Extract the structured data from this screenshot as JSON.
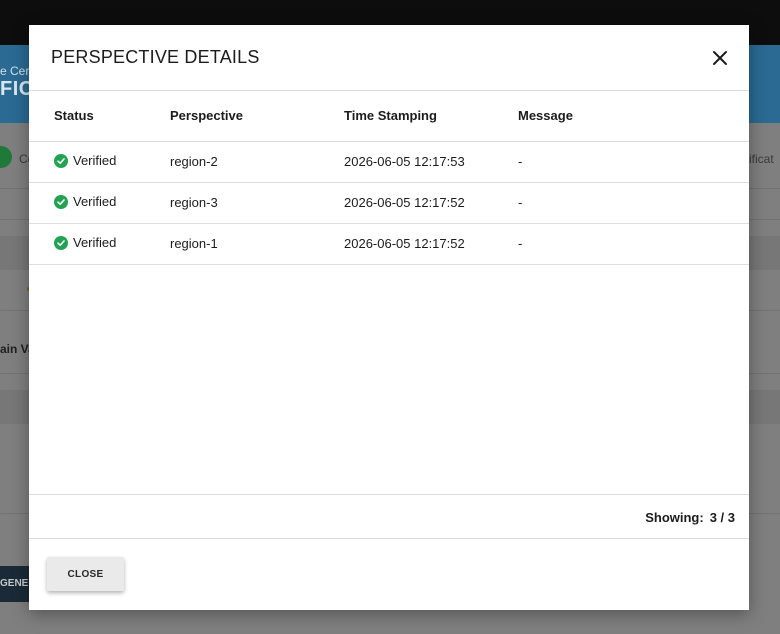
{
  "background": {
    "header_small": "e Cer",
    "header_big": "FICA",
    "row_left_text": "Co",
    "row_right_text": "ificat",
    "bold_text": "ain Va",
    "button_label": "GENER"
  },
  "modal": {
    "title": "PERSPECTIVE DETAILS",
    "close_icon": "close-icon",
    "columns": {
      "status": "Status",
      "perspective": "Perspective",
      "time": "Time Stamping",
      "message": "Message"
    },
    "rows": [
      {
        "status": "Verified",
        "perspective": "region-2",
        "time": "2026-06-05 12:17:53",
        "message": "-"
      },
      {
        "status": "Verified",
        "perspective": "region-3",
        "time": "2026-06-05 12:17:52",
        "message": "-"
      },
      {
        "status": "Verified",
        "perspective": "region-1",
        "time": "2026-06-05 12:17:52",
        "message": "-"
      }
    ],
    "showing_label": "Showing:",
    "showing_count": "3 / 3",
    "close_button": "CLOSE",
    "status_color": "#22a351"
  }
}
